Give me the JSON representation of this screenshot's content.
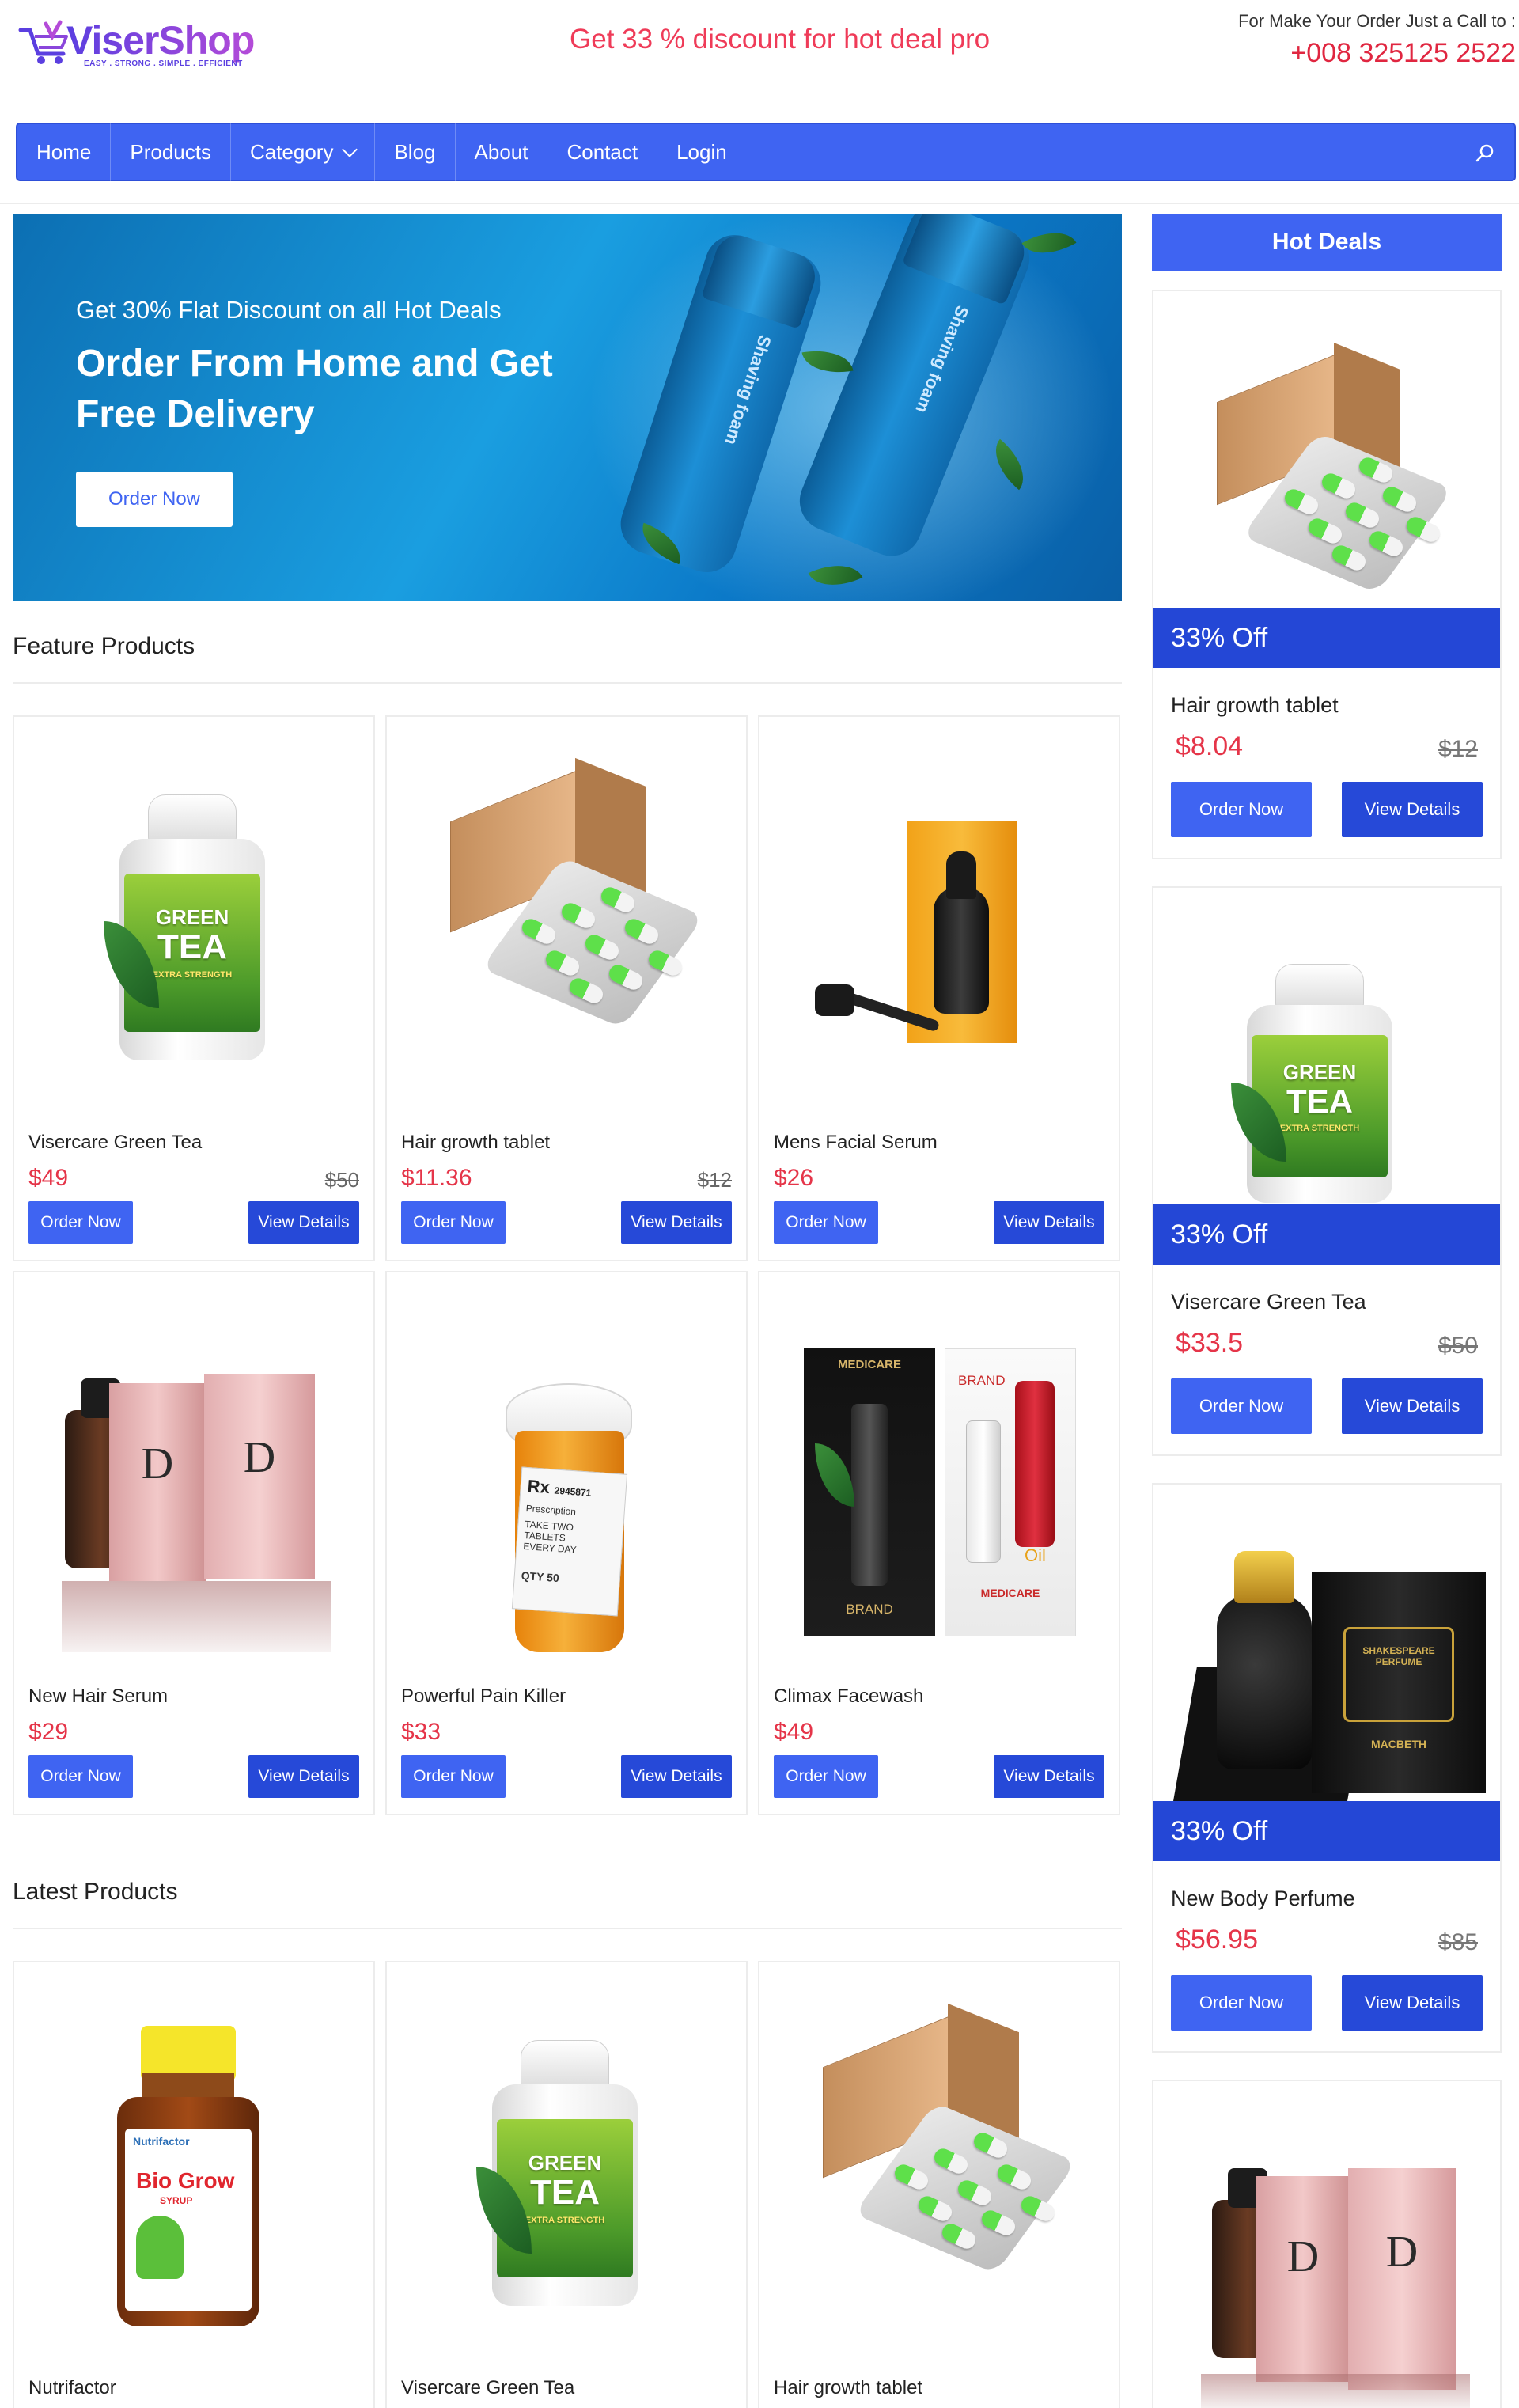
{
  "header": {
    "logo_name": "ViserShop",
    "logo_tagline": "EASY . STRONG . SIMPLE . EFFICIENT",
    "marquee_text": "Get 33 % discount for hot deal pro",
    "call_label": "For Make Your Order Just a Call to :",
    "call_phone": "+008 325125 2522"
  },
  "nav": {
    "items": [
      "Home",
      "Products",
      "Category",
      "Blog",
      "About",
      "Contact",
      "Login"
    ],
    "search_icon": "search-icon",
    "category_chevron": "chevron-down-icon"
  },
  "hero": {
    "subtitle": "Get 30% Flat Discount on all Hot Deals",
    "title": "Order From Home and Get Free Delivery",
    "button": "Order Now",
    "bottle_text_1": "Shaving foam",
    "bottle_text_2": "Shaving foam"
  },
  "feature": {
    "title": "Feature Products",
    "products": [
      {
        "name": "Visercare Green Tea",
        "price": "$49",
        "old_price": "$50",
        "order": "Order Now",
        "view": "View Details"
      },
      {
        "name": "Hair growth tablet",
        "price": "$11.36",
        "old_price": "$12",
        "order": "Order Now",
        "view": "View Details"
      },
      {
        "name": "Mens Facial Serum",
        "price": "$26",
        "old_price": "",
        "order": "Order Now",
        "view": "View Details"
      },
      {
        "name": "New Hair Serum",
        "price": "$29",
        "old_price": "",
        "order": "Order Now",
        "view": "View Details"
      },
      {
        "name": "Powerful Pain Killer",
        "price": "$33",
        "old_price": "",
        "order": "Order Now",
        "view": "View Details"
      },
      {
        "name": "Climax Facewash",
        "price": "$49",
        "old_price": "",
        "order": "Order Now",
        "view": "View Details"
      }
    ]
  },
  "latest": {
    "title": "Latest Products",
    "products": [
      {
        "name": "Nutrifactor"
      },
      {
        "name": "Visercare Green Tea"
      },
      {
        "name": "Hair growth tablet"
      }
    ]
  },
  "hot_deals": {
    "title": "Hot Deals",
    "deals": [
      {
        "discount": "33% Off",
        "name": "Hair growth tablet",
        "price": "$8.04",
        "old_price": "$12",
        "order": "Order Now",
        "view": "View Details"
      },
      {
        "discount": "33% Off",
        "name": "Visercare Green Tea",
        "price": "$33.5",
        "old_price": "$50",
        "order": "Order Now",
        "view": "View Details"
      },
      {
        "discount": "33% Off",
        "name": "New Body Perfume",
        "price": "$56.95",
        "old_price": "$85",
        "order": "Order Now",
        "view": "View Details"
      }
    ]
  },
  "product_image_text": {
    "green_tea_1": "GREEN",
    "green_tea_2": "TEA",
    "green_tea_3": "EXTRA STRENGTH",
    "hair_serum_letter": "D",
    "painkiller_rx": "Rx",
    "painkiller_rx_number": "2945871",
    "painkiller_presc": "Prescription",
    "painkiller_take": "TAKE TWO TABLETS",
    "painkiller_every": "EVERY DAY",
    "painkiller_qty": "QTY 50",
    "facewash_brand": "MEDICARE",
    "facewash_brand2": "BRAND",
    "facewash_oil": "Oil",
    "nutrifactor_brand": "Nutrifactor",
    "nutrifactor_name": "Bio Grow",
    "nutrifactor_syrup": "SYRUP",
    "perfume_label": "SHAKESPEARE PERFUME",
    "perfume_sub": "MACBETH"
  },
  "colors": {
    "brand_blue": "#3f64f2",
    "deal_blue": "#2447d6",
    "price_red": "#e53549",
    "marquee_red": "#ef3b58"
  }
}
